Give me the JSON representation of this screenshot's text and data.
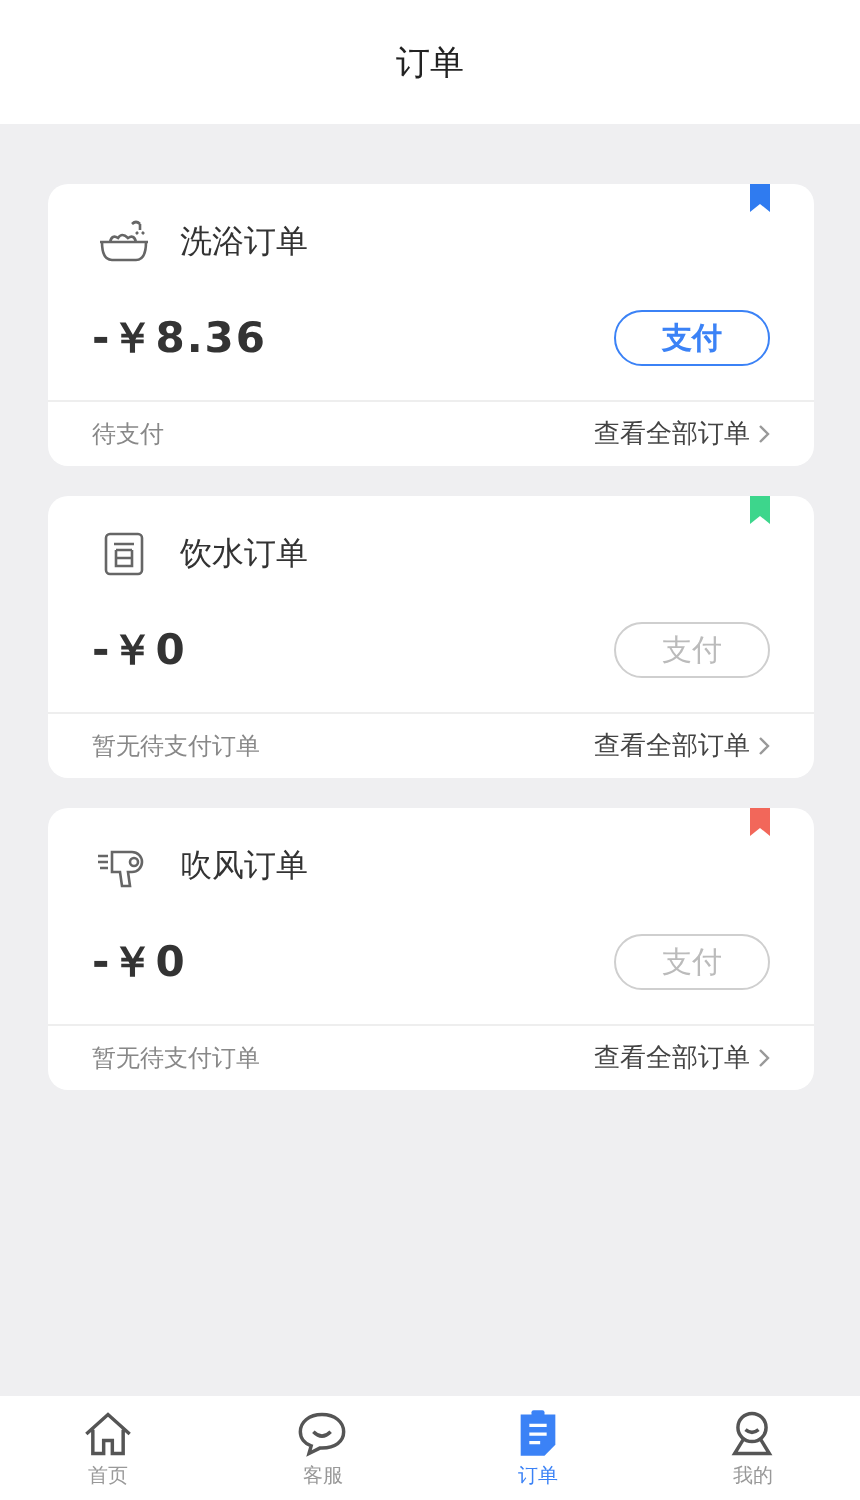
{
  "header": {
    "title": "订单"
  },
  "orders": [
    {
      "kind": "bath",
      "name": "洗浴订单",
      "color": "#2f7bf0",
      "amount": "-￥8.36",
      "pay": {
        "label": "支付",
        "disabled": false
      },
      "status": "待支付",
      "link": "查看全部订单"
    },
    {
      "kind": "water",
      "name": "饮水订单",
      "color": "#3dd68c",
      "amount": "-￥0",
      "pay": {
        "label": "支付",
        "disabled": true
      },
      "status": "暂无待支付订单",
      "link": "查看全部订单"
    },
    {
      "kind": "dryer",
      "name": "吹风订单",
      "color": "#f2675a",
      "amount": "-￥0",
      "pay": {
        "label": "支付",
        "disabled": true
      },
      "status": "暂无待支付订单",
      "link": "查看全部订单"
    }
  ],
  "tabbar": [
    {
      "kind": "home",
      "label": "首页",
      "selected": false
    },
    {
      "kind": "chat",
      "label": "客服",
      "selected": false
    },
    {
      "kind": "orders",
      "label": "订单",
      "selected": true
    },
    {
      "kind": "me",
      "label": "我的",
      "selected": false
    }
  ]
}
